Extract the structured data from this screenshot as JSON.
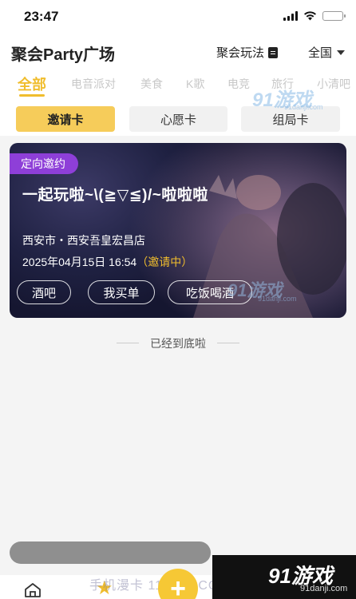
{
  "status_bar": {
    "time": "23:47"
  },
  "header": {
    "title": "聚会Party广场",
    "gameplay_link": "聚会玩法",
    "region": "全国"
  },
  "category_tabs": [
    "全部",
    "电音派对",
    "美食",
    "K歌",
    "电竞",
    "旅行",
    "小清吧"
  ],
  "card_tabs": [
    "邀请卡",
    "心愿卡",
    "组局卡"
  ],
  "event": {
    "tag": "定向邀约",
    "title": "一起玩啦~\\(≧▽≦)/~啦啦啦",
    "location": "西安市・西安吾皇宏昌店",
    "datetime": "2025年04月15日 16:54",
    "status": "（邀请中）",
    "chips": [
      "酒吧",
      "我买单",
      "吃饭喝酒"
    ]
  },
  "end_note": "已经到底啦",
  "bottom_bar": {
    "add_label": "+"
  },
  "watermarks": {
    "brand": "91游戏",
    "domain": "91danji.com",
    "site": "手机漫卡  11WAX.COM"
  },
  "colors": {
    "accent": "#f0bd2d",
    "tag": "#8e3fd8",
    "active_card_tab": "#f6cc5a"
  }
}
